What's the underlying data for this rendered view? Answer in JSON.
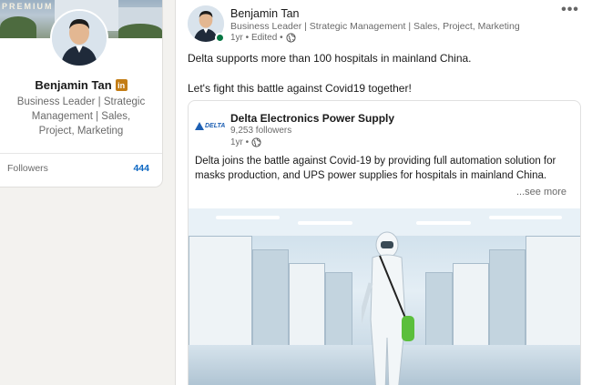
{
  "profile": {
    "cover_label": "PREMIUM",
    "name": "Benjamin Tan",
    "badge": "in",
    "headline": "Business Leader | Strategic Management | Sales, Project, Marketing",
    "followers_label": "Followers",
    "followers_count": "444"
  },
  "post": {
    "author_name": "Benjamin Tan",
    "author_headline": "Business Leader | Strategic Management | Sales, Project, Marketing",
    "meta": "1yr • Edited •",
    "more_label": "•••",
    "text_line1": "Delta supports more than 100 hospitals in mainland China.",
    "text_line2": "Let's fight this battle against Covid19 together!",
    "shared": {
      "logo_text": "DELTA",
      "company_name": "Delta Electronics Power Supply",
      "followers": "9,253 followers",
      "meta": "1yr •",
      "text": "Delta joins the battle against Covid-19 by providing full automation solution for masks production, and UPS power supplies for hospitals in mainland China.",
      "see_more": "...see more"
    }
  },
  "colors": {
    "link_blue": "#0a66c2",
    "premium_gold": "#c37d16",
    "online_green": "#057642",
    "background": "#f3f2ef"
  },
  "icons": [
    "globe-icon",
    "linkedin-premium-badge",
    "more-options-icon",
    "delta-logo"
  ]
}
